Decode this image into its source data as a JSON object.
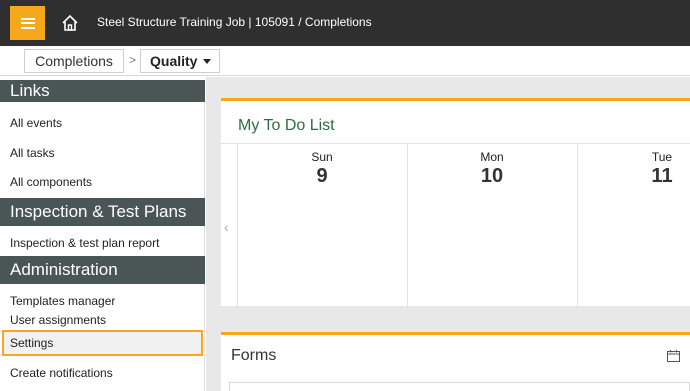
{
  "header": {
    "title": "Steel Structure Training Job | 105091  /  Completions",
    "menu_icon": "hamburger-icon",
    "home_icon": "home-icon",
    "accent_color": "#f5a81c"
  },
  "breadcrumb": {
    "root": "Completions",
    "current": "Quality"
  },
  "sidebar": {
    "sections": [
      {
        "title": "Links",
        "items": [
          "All events",
          "All tasks",
          "All components"
        ]
      },
      {
        "title": "Inspection & Test Plans",
        "items": [
          "Inspection & test plan report"
        ]
      },
      {
        "title": "Administration",
        "items": [
          "Templates manager",
          "User assignments",
          "Settings",
          "Create notifications"
        ]
      }
    ],
    "selected_item": "Settings"
  },
  "todo": {
    "title": "My To Do List",
    "days": [
      {
        "name": "Sun",
        "num": "9"
      },
      {
        "name": "Mon",
        "num": "10"
      },
      {
        "name": "Tue",
        "num": "11"
      }
    ]
  },
  "forms": {
    "title": "Forms",
    "icon": "calendar-icon"
  }
}
